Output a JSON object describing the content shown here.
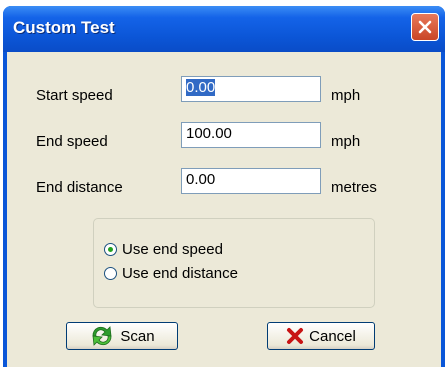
{
  "window": {
    "title": "Custom Test"
  },
  "fields": [
    {
      "label": "Start speed",
      "value": "0.00",
      "unit": "mph"
    },
    {
      "label": "End speed",
      "value": "100.00",
      "unit": "mph"
    },
    {
      "label": "End distance",
      "value": "0.00",
      "unit": "metres"
    }
  ],
  "options": {
    "use_end_speed": "Use end speed",
    "use_end_distance": "Use end distance",
    "selected": "use_end_speed"
  },
  "buttons": {
    "scan": "Scan",
    "cancel": "Cancel"
  },
  "icons": {
    "close": "close-icon",
    "scan": "refresh-arrows-icon",
    "cancel": "red-x-icon"
  },
  "colors": {
    "titlebar": "#0a56d8",
    "client": "#ece9d8",
    "selection": "#316ac5",
    "radio_dot": "#21a121"
  }
}
